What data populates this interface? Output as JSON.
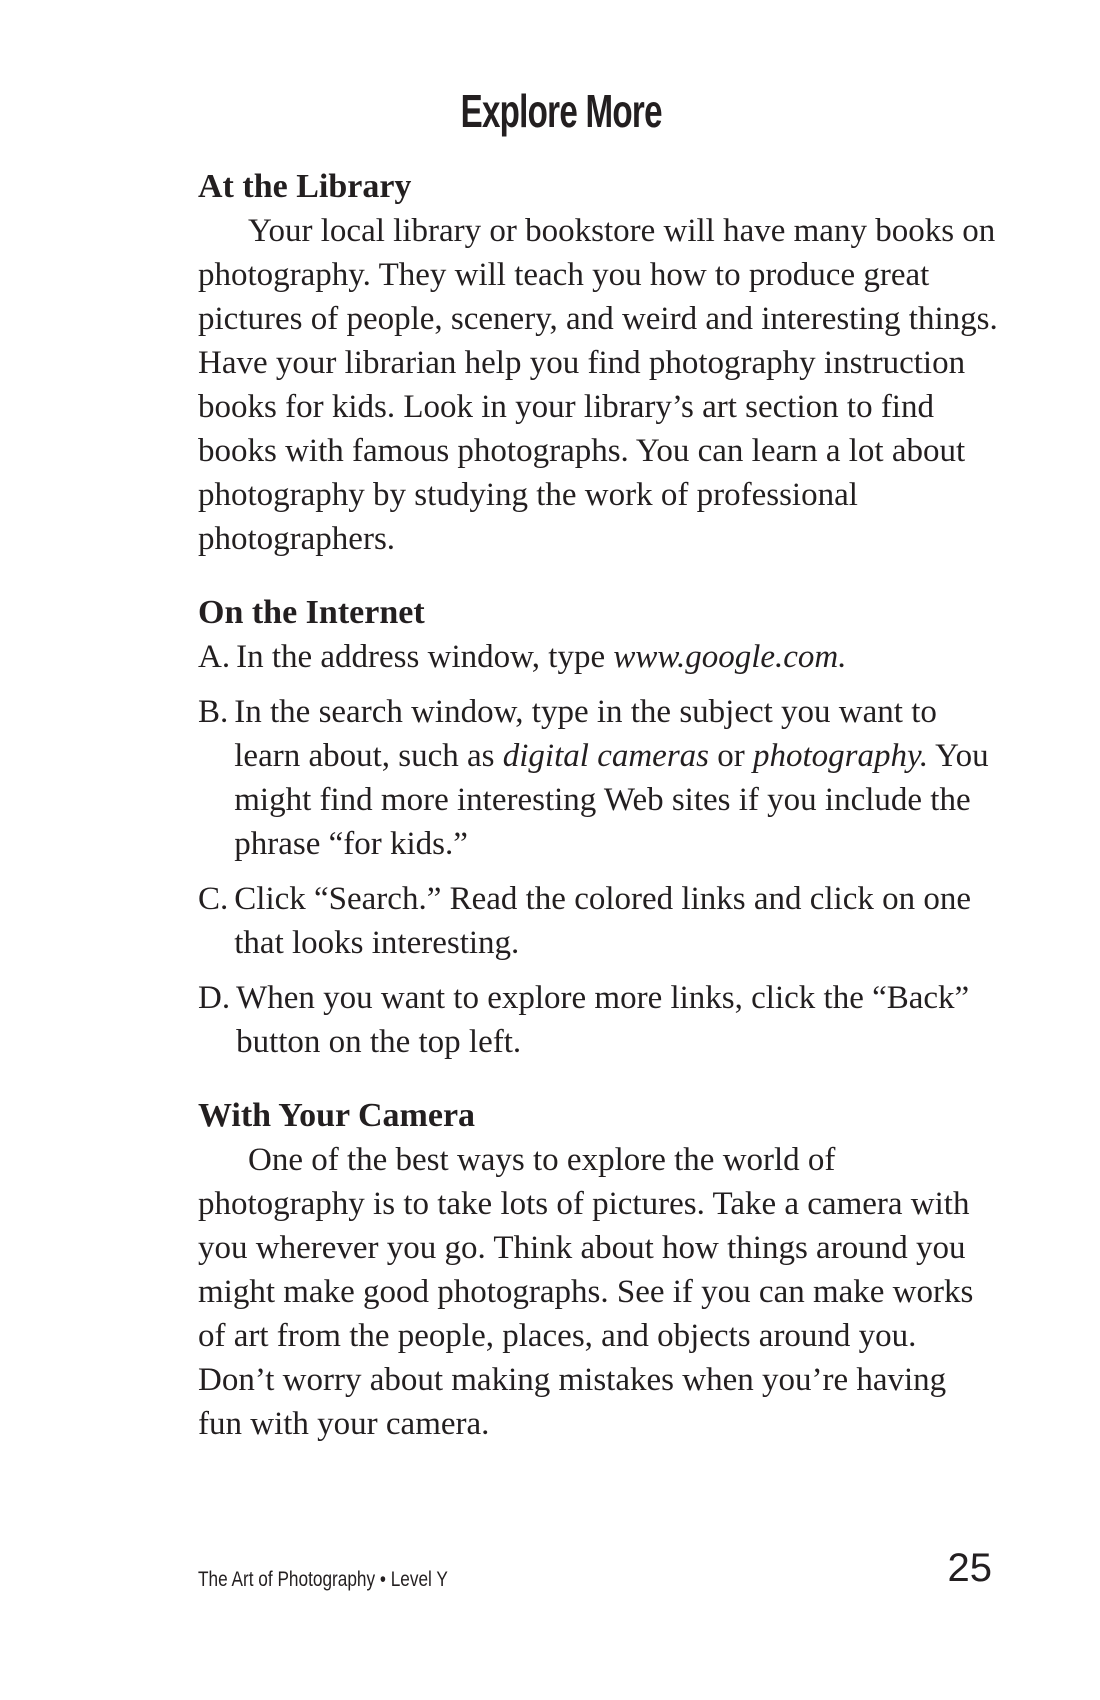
{
  "page": {
    "title": "Explore More",
    "footer": "The Art of Photography • Level Y",
    "page_number": "25"
  },
  "library": {
    "heading": "At the Library",
    "paragraph": "Your local library or bookstore will have many books on photography. They will teach you how to produce great pictures of people, scenery, and weird and interesting things. Have your librarian help you find photography instruction books for kids. Look in your library’s art section to find books with famous photographs. You can learn a lot about photography by studying the work of professional photographers."
  },
  "internet": {
    "heading": "On the Internet",
    "steps": [
      {
        "letter": "A.",
        "parts": [
          {
            "text": "In the address window, type "
          },
          {
            "text": "www.google.com.",
            "italic": true
          }
        ]
      },
      {
        "letter": "B.",
        "parts": [
          {
            "text": "In the search window, type in the subject you want to learn about, such as "
          },
          {
            "text": "digital cameras",
            "italic": true
          },
          {
            "text": " or "
          },
          {
            "text": "photography.",
            "italic": true
          },
          {
            "text": " You might find more interesting Web sites if you include the phrase “for kids.”"
          }
        ]
      },
      {
        "letter": "C.",
        "parts": [
          {
            "text": "Click “Search.” Read the colored links and click on one that looks interesting."
          }
        ]
      },
      {
        "letter": "D.",
        "parts": [
          {
            "text": "When you want to explore more links, click the “Back” button on the top left."
          }
        ]
      }
    ]
  },
  "camera": {
    "heading": "With Your Camera",
    "paragraph": "One of the best ways to explore the world of photography is to take lots of pictures. Take a camera with you wherever you go. Think about how things around you might make good photographs. See if you can make works of art from the people, places, and objects around you. Don’t worry about making mistakes when you’re having fun with your camera."
  }
}
